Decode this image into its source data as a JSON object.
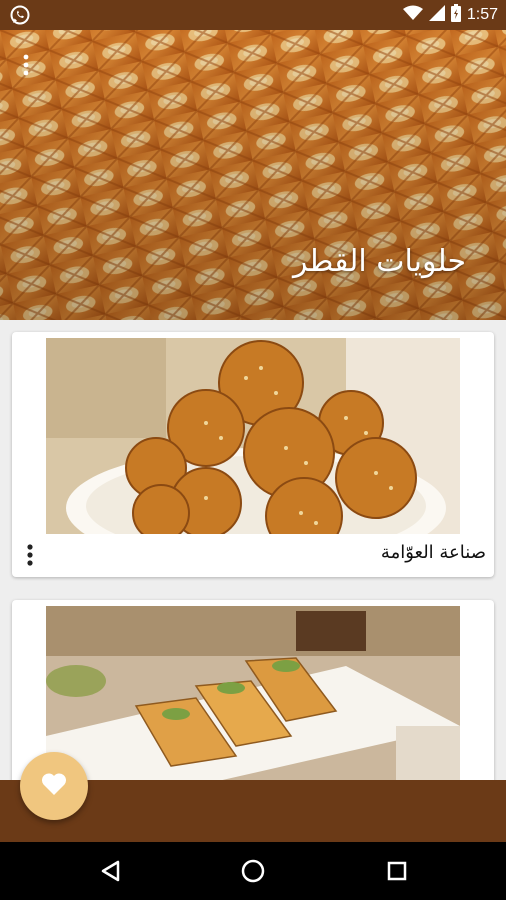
{
  "status_bar": {
    "time": "1:57",
    "left_icon": "whatsapp-icon",
    "right_icons": [
      "wifi-icon",
      "signal-icon",
      "battery-icon"
    ]
  },
  "header": {
    "title": "حلويات القطر",
    "menu_icon": "more-vert-icon"
  },
  "recipes": [
    {
      "title": "صناعة العوّامة",
      "image": "luqaimat-photo",
      "menu_icon": "more-vert-icon"
    },
    {
      "title": "",
      "image": "basbousa-photo"
    }
  ],
  "fab": {
    "icon": "heart-icon"
  },
  "nav": {
    "buttons": [
      "back-icon",
      "home-icon",
      "recents-icon"
    ]
  },
  "colors": {
    "brand_brown": "#6b3a17",
    "fab": "#f0c67f",
    "card": "#ffffff"
  }
}
